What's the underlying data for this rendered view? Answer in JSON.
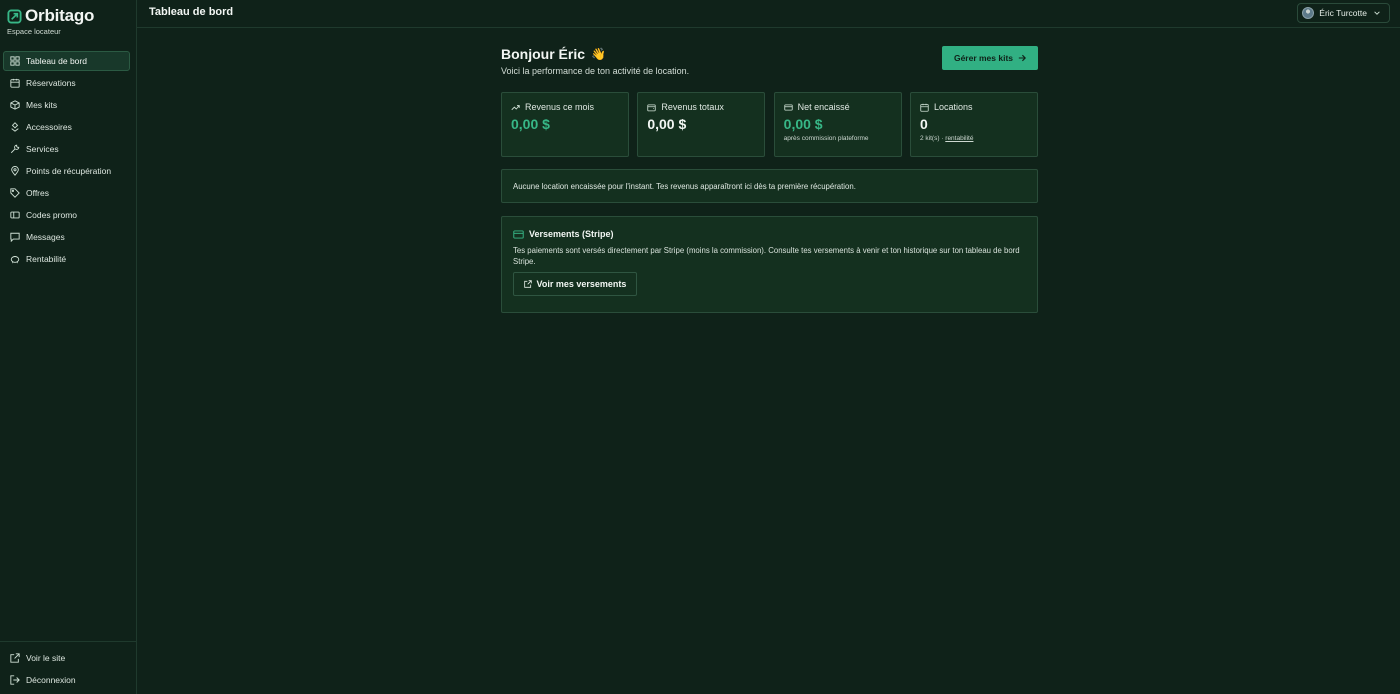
{
  "brand": {
    "name": "Orbitago",
    "subtitle": "Espace locateur"
  },
  "sidebar": {
    "items": [
      {
        "label": "Tableau de bord",
        "icon": "dashboard-icon",
        "active": true
      },
      {
        "label": "Réservations",
        "icon": "calendar-icon"
      },
      {
        "label": "Mes kits",
        "icon": "package-icon"
      },
      {
        "label": "Accessoires",
        "icon": "accessories-icon"
      },
      {
        "label": "Services",
        "icon": "wrench-icon"
      },
      {
        "label": "Points de récupération",
        "icon": "map-pin-icon"
      },
      {
        "label": "Offres",
        "icon": "tag-icon"
      },
      {
        "label": "Codes promo",
        "icon": "ticket-icon"
      },
      {
        "label": "Messages",
        "icon": "message-icon"
      },
      {
        "label": "Rentabilité",
        "icon": "piggy-bank-icon"
      }
    ],
    "bottom": [
      {
        "label": "Voir le site",
        "icon": "external-link-icon"
      },
      {
        "label": "Déconnexion",
        "icon": "logout-icon"
      }
    ]
  },
  "topbar": {
    "title": "Tableau de bord",
    "user": "Éric Turcotte"
  },
  "main": {
    "greeting": "Bonjour Éric",
    "greeting_emoji": "👋",
    "subtitle": "Voici la performance de ton activité de location.",
    "cta_label": "Gérer mes kits"
  },
  "stats": [
    {
      "label": "Revenus ce mois",
      "value": "0,00 $",
      "icon": "trending-up-icon",
      "accent": "#37b787"
    },
    {
      "label": "Revenus totaux",
      "value": "0,00 $",
      "icon": "wallet-icon"
    },
    {
      "label": "Net encaissé",
      "value": "0,00 $",
      "icon": "credit-card-icon",
      "note": "après commission plateforme",
      "accent": "#37b787"
    },
    {
      "label": "Locations",
      "value": "0",
      "icon": "calendar-icon",
      "note": "2 kit(s) ·",
      "note_link": "rentabilité"
    }
  ],
  "notice": "Aucune location encaissée pour l'instant. Tes revenus apparaîtront ici dès ta première récupération.",
  "payout": {
    "title": "Versements (Stripe)",
    "text": "Tes paiements sont versés directement par Stripe (moins la commission). Consulte tes versements à venir et ton historique sur ton tableau de bord Stripe.",
    "button": "Voir mes versements"
  },
  "colors": {
    "background": "#0f2219",
    "card": "#14301f",
    "accent": "#31b083"
  }
}
